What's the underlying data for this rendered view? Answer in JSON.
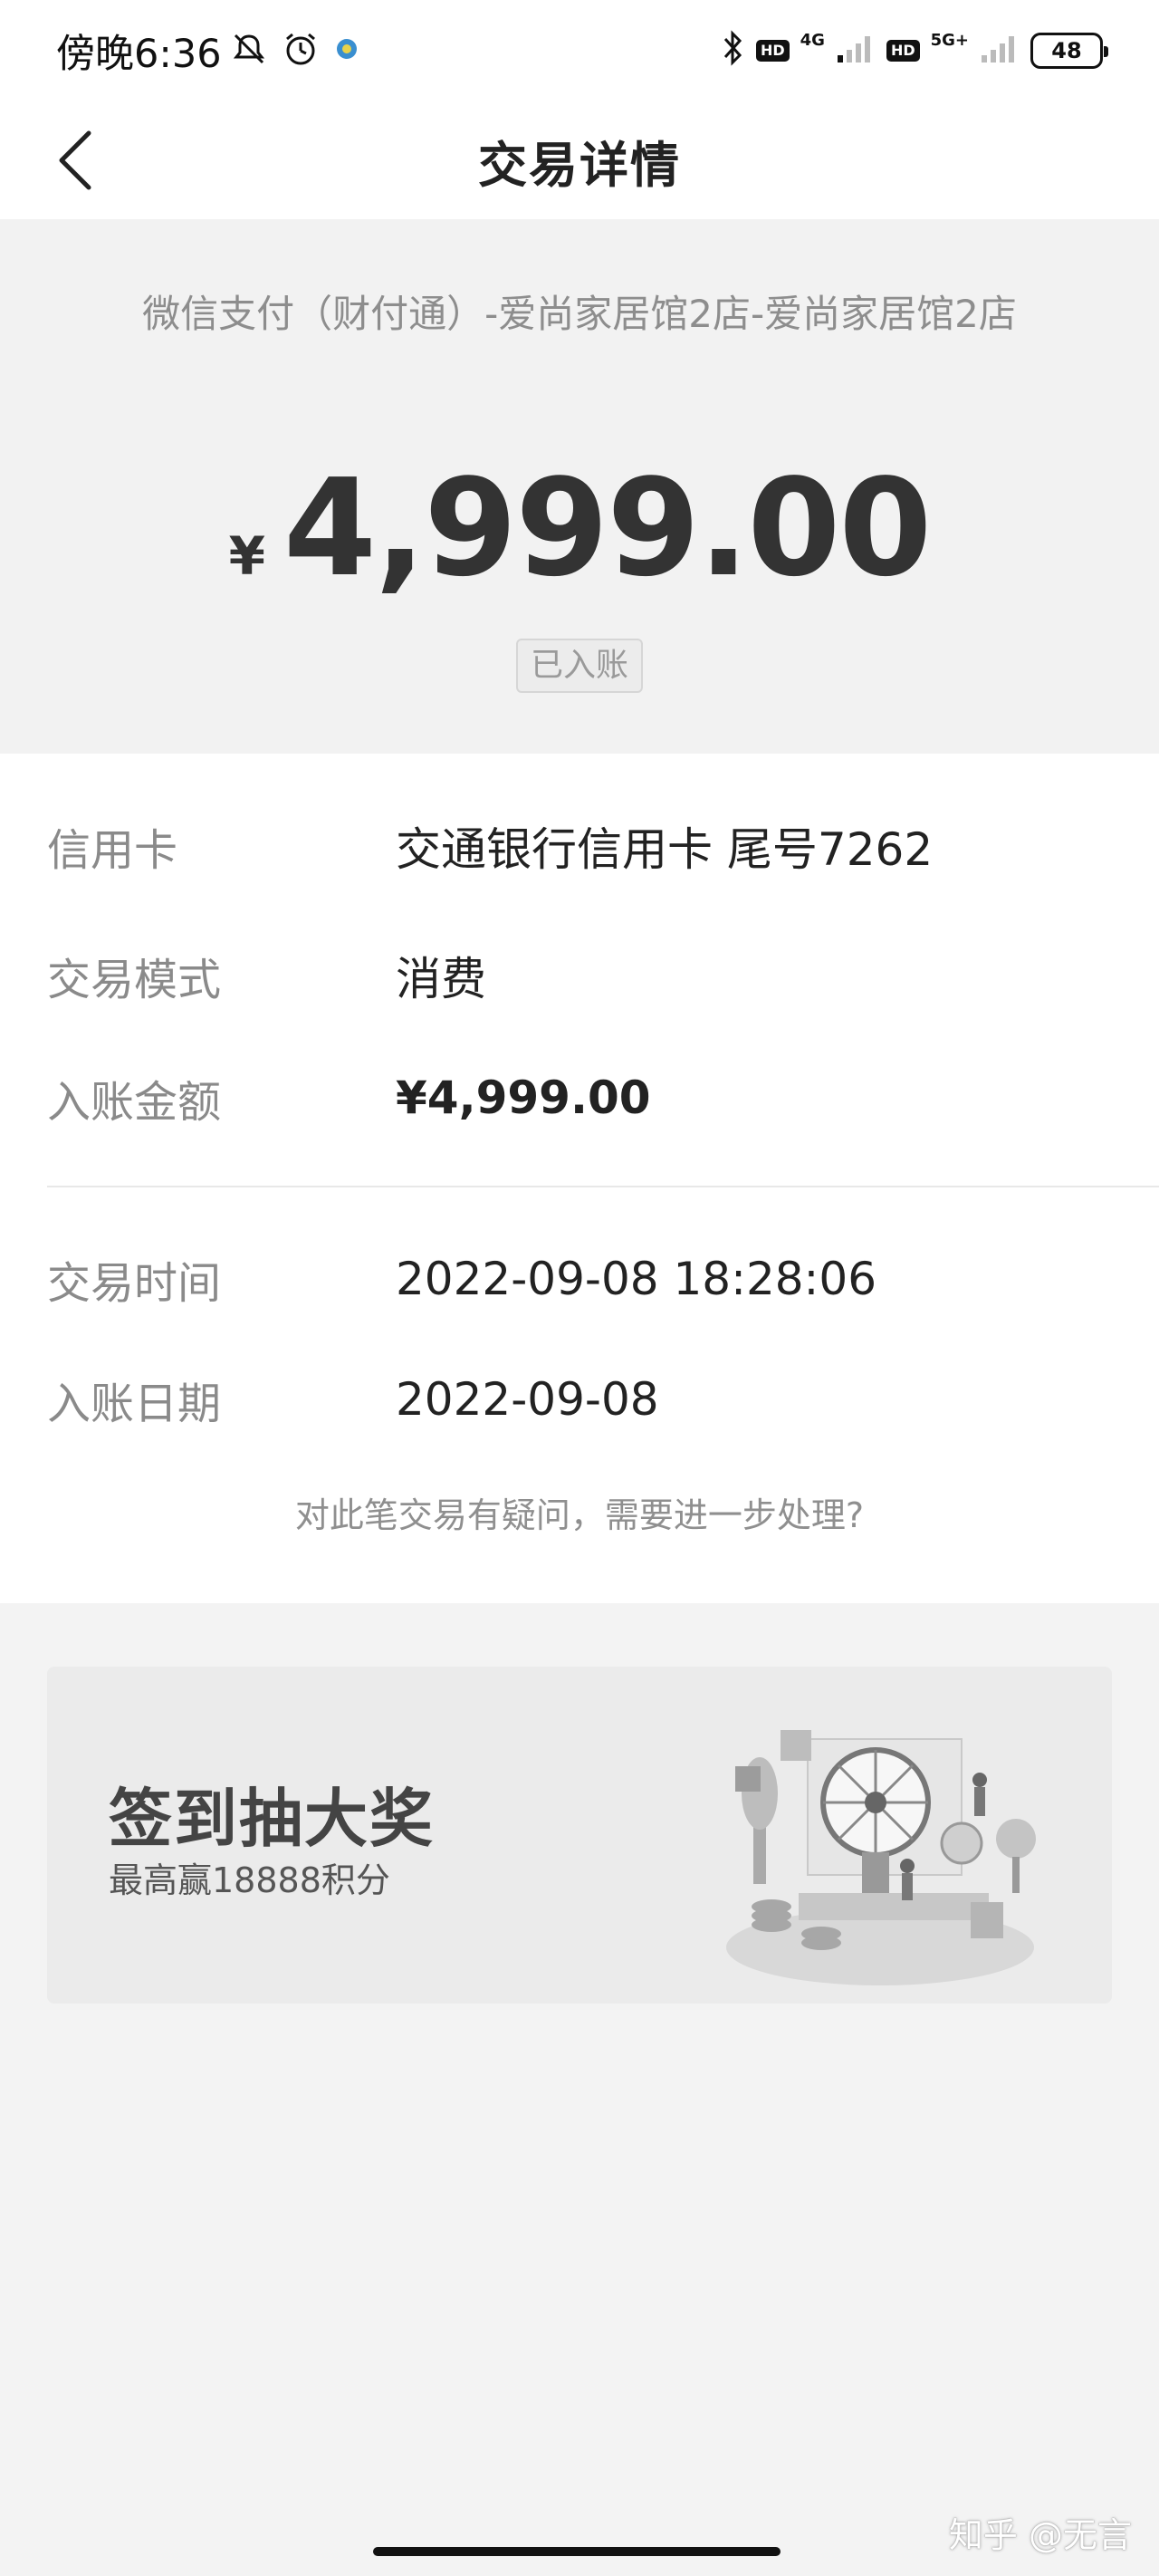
{
  "status_bar": {
    "time": "傍晚6:36",
    "network_1": "4G",
    "network_2": "5G+",
    "hd": "HD",
    "battery": "48"
  },
  "nav": {
    "title": "交易详情"
  },
  "summary": {
    "merchant": "微信支付（财付通）-爱尚家居馆2店-爱尚家居馆2店",
    "currency_symbol": "¥",
    "amount": "4,999.00",
    "status": "已入账"
  },
  "details": {
    "rows": [
      {
        "label": "信用卡",
        "value": "交通银行信用卡 尾号7262"
      },
      {
        "label": "交易模式",
        "value": "消费"
      },
      {
        "label": "入账金额",
        "value": "¥4,999.00"
      },
      {
        "label": "交易时间",
        "value": "2022-09-08 18:28:06"
      },
      {
        "label": "入账日期",
        "value": "2022-09-08"
      }
    ],
    "help_text": "对此笔交易有疑问，需要进一步处理?"
  },
  "banner": {
    "title": "签到抽大奖",
    "subtitle": "最高赢18888积分"
  },
  "watermark": "知乎 @无言"
}
